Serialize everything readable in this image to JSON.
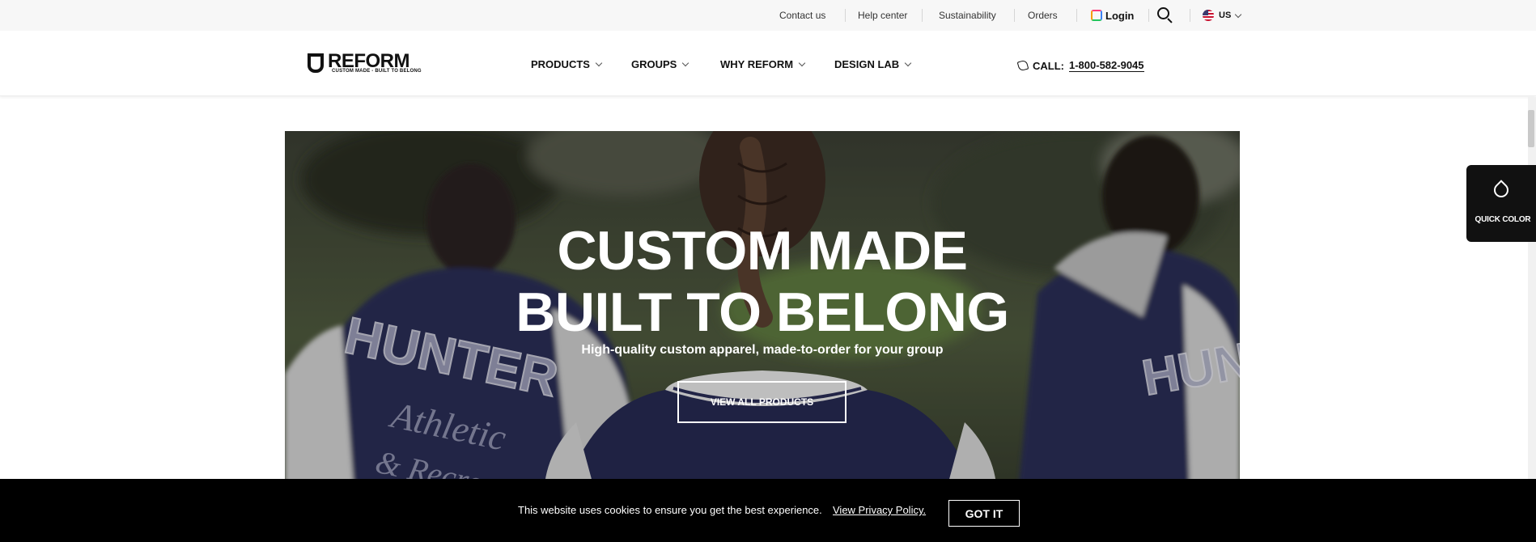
{
  "utility": {
    "links": [
      "Contact us",
      "Help center",
      "Sustainability",
      "Orders"
    ],
    "login": "Login",
    "locale": "US"
  },
  "icons": {
    "login": "reform-app-icon",
    "search": "search-icon",
    "flag": "us-flag-icon",
    "phone": "phone-icon",
    "quick_color": "drop-icon"
  },
  "brand": {
    "name": "REFORM",
    "tagline": "CUSTOM MADE - BUILT TO BELONG"
  },
  "nav": {
    "items": [
      "PRODUCTS",
      "GROUPS",
      "WHY REFORM",
      "DESIGN LAB"
    ],
    "call_label": "CALL:",
    "call_number": "1-800-582-9045"
  },
  "hero": {
    "title_line1": "CUSTOM MADE",
    "title_line2": "BUILT TO BELONG",
    "subtitle": "High-quality custom apparel, made-to-order for your group",
    "cta": "VIEW ALL PRODUCTS"
  },
  "quick_color": {
    "label": "QUICK COLOR"
  },
  "cookie": {
    "text": "This website uses cookies to ensure you get the best experience.",
    "link": "View Privacy Policy.",
    "button": "GOT IT"
  },
  "colors": {
    "utility_bg": "#f7f7f7",
    "text": "#111111",
    "cookie_bg": "#000000",
    "jacket_navy": "#2a2d56",
    "sleeve_cream": "#d8d8d8"
  }
}
